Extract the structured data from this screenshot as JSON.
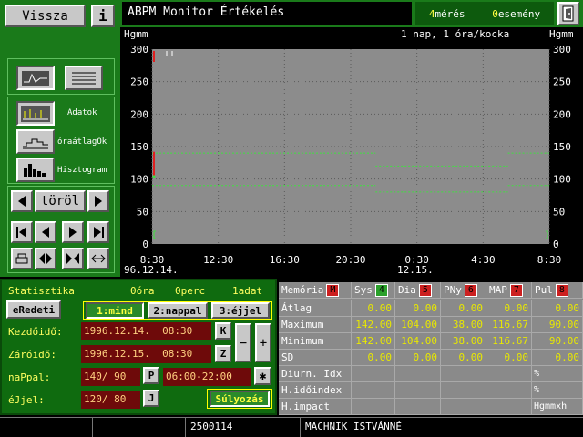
{
  "top": {
    "back_label": "Vissza",
    "info_label": "i",
    "title": "ABPM Monitor Értékelés",
    "measurements_count": "4",
    "measurements_label": "mérés",
    "events_count": "0",
    "events_label": "esemény"
  },
  "side": {
    "adatok_label": "Adatok",
    "oraatlag_label": "óraátlagOk",
    "hisztogram_label": "Hisztogram",
    "torol_label": "töröl"
  },
  "chart_data": {
    "type": "line",
    "ylabel_left": "Hgmm",
    "ylabel_right": "Hgmm",
    "scale_label": "1 nap, 1 óra/kocka",
    "ylim": [
      0,
      300
    ],
    "yticks": [
      "300",
      "250",
      "200",
      "150",
      "100",
      "50",
      "0"
    ],
    "xticks": [
      "8:30",
      "12:30",
      "16:30",
      "20:30",
      "0:30",
      "4:30",
      "8:30"
    ],
    "date_start": "96.12.14.",
    "date_mid": "12.15.",
    "sys_limit": {
      "day": 140,
      "night": 120
    },
    "dia_limit": {
      "day": 90,
      "night": 80
    },
    "measurement": {
      "time": "8:30",
      "sys": 142,
      "dia": 104
    }
  },
  "stats": {
    "title": "Statisztika",
    "hours": "0óra",
    "minutes": "0perc",
    "count": "1adat",
    "eredeti_label": "eRedeti",
    "tabs": [
      "1:mind",
      "2:nappal",
      "3:éjjel"
    ],
    "start_label": "Kezdőidő:",
    "start_value": "1996.12.14.  08:30",
    "start_key": "K",
    "end_label": "Záróidő:",
    "end_value": "1996.12.15.  08:30",
    "end_key": "Z",
    "minus": "−",
    "plus": "+",
    "day_label": "naPpal:",
    "day_value": "140/ 90",
    "day_key": "P",
    "day_range": "06:00-22:00",
    "night_label": "éJjel:",
    "night_value": "120/ 80",
    "night_key": "J",
    "star": "✱",
    "sulyozas_label": "Súlyozás"
  },
  "table": {
    "headers": [
      {
        "label": "Memória",
        "key": "M"
      },
      {
        "label": "Sys",
        "key": "4"
      },
      {
        "label": "Dia",
        "key": "5"
      },
      {
        "label": "PNy",
        "key": "6"
      },
      {
        "label": "MAP",
        "key": "7"
      },
      {
        "label": "Pul",
        "key": "8"
      }
    ],
    "rows": [
      {
        "label": "Átlag",
        "values": [
          "0.00",
          "0.00",
          "0.00",
          "0.00",
          "0.00"
        ]
      },
      {
        "label": "Maximum",
        "values": [
          "142.00",
          "104.00",
          "38.00",
          "116.67",
          "90.00"
        ]
      },
      {
        "label": "Minimum",
        "values": [
          "142.00",
          "104.00",
          "38.00",
          "116.67",
          "90.00"
        ]
      },
      {
        "label": "SD",
        "values": [
          "0.00",
          "0.00",
          "0.00",
          "0.00",
          "0.00"
        ]
      },
      {
        "label": "Diurn. Idx",
        "values": [
          "",
          "",
          "",
          "",
          "%"
        ]
      },
      {
        "label": "H.időindex",
        "values": [
          "",
          "",
          "",
          "",
          "%"
        ]
      },
      {
        "label": "H.impact",
        "values": [
          "",
          "",
          "",
          "",
          "Hgmmxh"
        ]
      }
    ]
  },
  "status": {
    "patient_id": "2500114",
    "patient_name": "MACHNIK ISTVÁNNÉ"
  }
}
